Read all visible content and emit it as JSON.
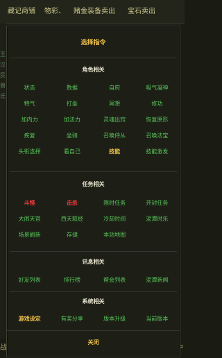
{
  "background": {
    "tabs": [
      "藏记商铺",
      "物彩、",
      "赌金装备卖出",
      "宝石卖出"
    ],
    "side_text": [
      "王",
      "汉",
      "民",
      "兽",
      "氏"
    ],
    "bottom_left": "战",
    "bottom_right": "中"
  },
  "modal": {
    "title": "选择指令",
    "sections": [
      {
        "title": "角色相关",
        "rows": [
          [
            {
              "label": "状态",
              "style": "normal"
            },
            {
              "label": "数据",
              "style": "normal"
            },
            {
              "label": "自府",
              "style": "normal"
            },
            {
              "label": "吸气凝神",
              "style": "normal"
            }
          ],
          [
            {
              "label": "特气",
              "style": "normal"
            },
            {
              "label": "打坐",
              "style": "normal"
            },
            {
              "label": "冥想",
              "style": "normal"
            },
            {
              "label": "修功",
              "style": "normal"
            }
          ],
          [
            {
              "label": "加内力",
              "style": "normal"
            },
            {
              "label": "加法力",
              "style": "normal"
            },
            {
              "label": "灵魂出窍",
              "style": "normal"
            },
            {
              "label": "恢复原形",
              "style": "normal"
            }
          ],
          [
            {
              "label": "疾复",
              "style": "normal"
            },
            {
              "label": "坐骑",
              "style": "normal"
            },
            {
              "label": "召唤侍从",
              "style": "normal"
            },
            {
              "label": "召唤法宝",
              "style": "normal"
            }
          ],
          [
            {
              "label": "头衔选择",
              "style": "normal"
            },
            {
              "label": "看自己",
              "style": "normal"
            },
            {
              "label": "技能",
              "style": "gold"
            },
            {
              "label": "技能激发",
              "style": "normal"
            }
          ]
        ]
      },
      {
        "title": "任务相关",
        "rows": [
          [
            {
              "label": "斗怪",
              "style": "red"
            },
            {
              "label": "击杀",
              "style": "red"
            },
            {
              "label": "限时任务",
              "style": "normal"
            },
            {
              "label": "开封任务",
              "style": "normal"
            }
          ],
          [
            {
              "label": "大闹天宫",
              "style": "normal"
            },
            {
              "label": "西天取经",
              "style": "normal"
            },
            {
              "label": "冷却时间",
              "style": "normal"
            },
            {
              "label": "泥潭时乐",
              "style": "normal"
            }
          ],
          [
            {
              "label": "场景刷新",
              "style": "normal"
            },
            {
              "label": "存储",
              "style": "normal"
            },
            {
              "label": "本站地图",
              "style": "normal"
            }
          ]
        ]
      },
      {
        "title": "讯息相关",
        "rows": [
          [
            {
              "label": "好友列表",
              "style": "normal"
            },
            {
              "label": "排行榜",
              "style": "normal"
            },
            {
              "label": "帮会列表",
              "style": "normal"
            },
            {
              "label": "泥潭新闻",
              "style": "normal"
            }
          ]
        ]
      },
      {
        "title": "系统相关",
        "rows": [
          [
            {
              "label": "游戏设定",
              "style": "gold"
            },
            {
              "label": "有奖分享",
              "style": "normal"
            },
            {
              "label": "版本升级",
              "style": "normal"
            },
            {
              "label": "当前版本",
              "style": "normal"
            }
          ]
        ]
      }
    ],
    "close_label": "关闭"
  }
}
